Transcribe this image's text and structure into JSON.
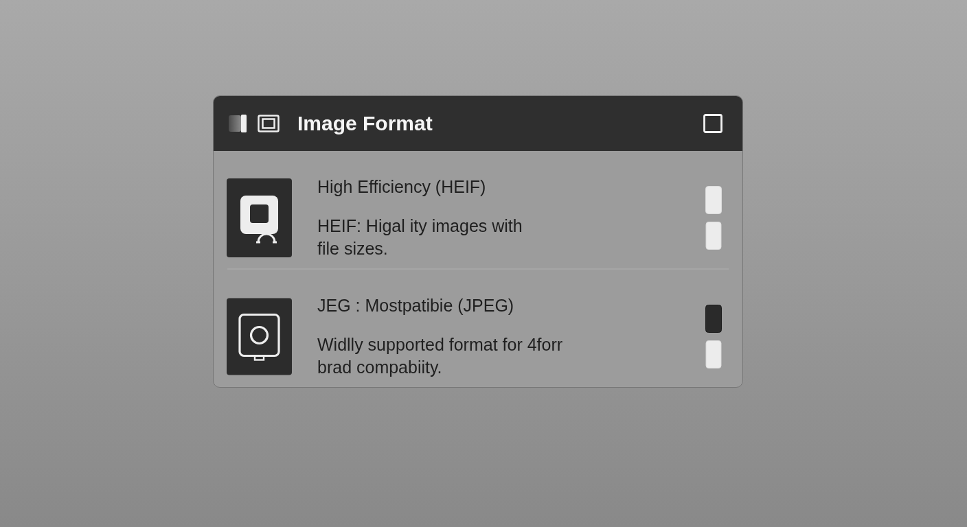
{
  "window": {
    "title": "Image Format"
  },
  "options": [
    {
      "kind": "heif",
      "title": "High Efficiency (HEIF)",
      "description_lines": [
        "HEIF: Higal ity images with",
        "file sizes."
      ],
      "selected": false
    },
    {
      "kind": "jpeg",
      "title": "JEG : Mostpatibie (JPEG)",
      "description_lines": [
        "Widlly supported format for 4forr",
        "brad compabiity."
      ],
      "selected": true
    }
  ]
}
